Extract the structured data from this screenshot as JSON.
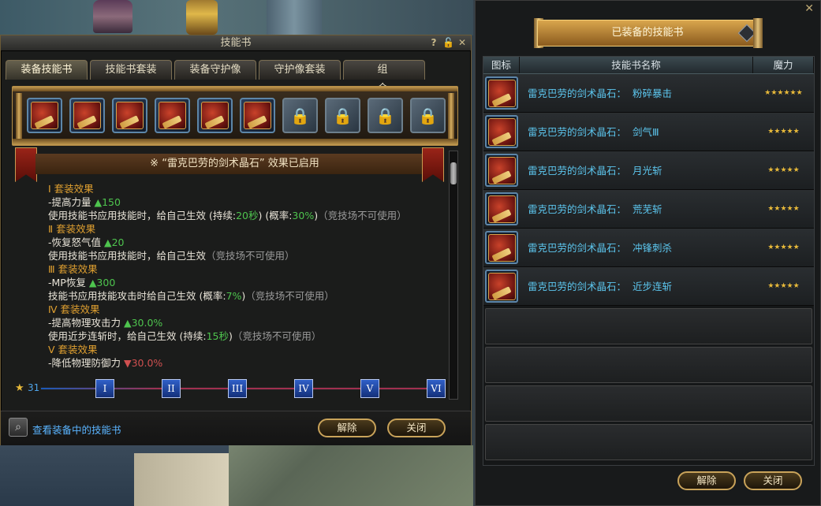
{
  "left_window": {
    "title": "技能书",
    "title_icons": {
      "help": "?",
      "lock": "🔓",
      "close": "✕"
    },
    "tabs": [
      "装备技能书",
      "技能书套装",
      "装备守护像",
      "守护像套装",
      "组合"
    ],
    "active_tab": 0,
    "slots": [
      {
        "type": "book",
        "icon": "skill-book-icon"
      },
      {
        "type": "book",
        "icon": "skill-book-icon"
      },
      {
        "type": "book",
        "icon": "skill-book-icon"
      },
      {
        "type": "book",
        "icon": "skill-book-icon"
      },
      {
        "type": "book",
        "icon": "skill-book-icon"
      },
      {
        "type": "book",
        "icon": "skill-book-icon"
      },
      {
        "type": "locked",
        "icon": "lock-icon"
      },
      {
        "type": "locked",
        "icon": "lock-icon"
      },
      {
        "type": "locked",
        "icon": "lock-icon"
      },
      {
        "type": "locked",
        "icon": "lock-icon"
      }
    ],
    "banner_text": "※ “雷克巴劳的剑术晶石” 效果已启用",
    "effects": [
      {
        "kind": "head",
        "text": "Ⅰ 套装效果"
      },
      {
        "kind": "stat",
        "label": "-提高力量 ",
        "value": "▲150",
        "color": "g"
      },
      {
        "kind": "desc",
        "text": "使用技能书应用技能时，给自己生效 (持续:",
        "a": "20秒",
        "b": ") (概率:",
        "c": "30%",
        "d": ")",
        "tail": "（竞技场不可使用）"
      },
      {
        "kind": "head",
        "text": "Ⅱ 套装效果"
      },
      {
        "kind": "stat",
        "label": "-恢复怒气值 ",
        "value": "▲20",
        "color": "g"
      },
      {
        "kind": "desc2",
        "text": "使用技能书应用技能时，给自己生效",
        "tail": "（竞技场不可使用）"
      },
      {
        "kind": "head",
        "text": "Ⅲ 套装效果"
      },
      {
        "kind": "stat",
        "label": "-MP恢复 ",
        "value": "▲300",
        "color": "g"
      },
      {
        "kind": "desc3",
        "text": "技能书应用技能攻击时给自己生效 (概率:",
        "a": "7%",
        "b": ")",
        "tail": "（竞技场不可使用）"
      },
      {
        "kind": "head",
        "text": "Ⅳ 套装效果"
      },
      {
        "kind": "stat",
        "label": "-提高物理攻击力 ",
        "value": "▲30.0%",
        "color": "g"
      },
      {
        "kind": "desc3",
        "text": "使用近步连斩时，给自己生效 (持续:",
        "a": "15秒",
        "b": ")",
        "tail": "（竞技场不可使用）"
      },
      {
        "kind": "head",
        "text": "Ⅴ 套装效果"
      },
      {
        "kind": "stat",
        "label": "-降低物理防御力 ",
        "value": "▼30.0%",
        "color": "r"
      }
    ],
    "progress": {
      "value": "31",
      "markers": [
        "I",
        "II",
        "III",
        "IV",
        "V",
        "VI"
      ]
    },
    "view_link": "查看装备中的技能书",
    "unequip_label": "解除",
    "close_label": "关闭"
  },
  "right_window": {
    "title": "已装备的技能书",
    "columns": [
      "图标",
      "技能书名称",
      "魔力"
    ],
    "rows": [
      {
        "name": "雷克巴劳的剑术晶石：  粉碎暴击",
        "stars": "★★★★★★"
      },
      {
        "name": "雷克巴劳的剑术晶石：  剑气Ⅲ",
        "stars": "★★★★★"
      },
      {
        "name": "雷克巴劳的剑术晶石：  月光斩",
        "stars": "★★★★★"
      },
      {
        "name": "雷克巴劳的剑术晶石：  荒芜斩",
        "stars": "★★★★★"
      },
      {
        "name": "雷克巴劳的剑术晶石：  冲锋刺杀",
        "stars": "★★★★★"
      },
      {
        "name": "雷克巴劳的剑术晶石：  近步连斩",
        "stars": "★★★★★"
      }
    ],
    "empty_rows": 4,
    "unequip_label": "解除",
    "close_label": "关闭",
    "close_icon": "✕"
  }
}
